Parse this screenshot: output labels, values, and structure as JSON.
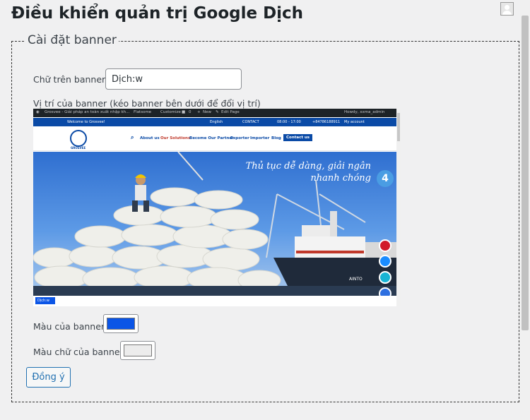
{
  "header": {
    "title": "Điều khiển quản trị Google Dịch"
  },
  "section": {
    "legend": "Cài đặt banner"
  },
  "form": {
    "banner_text_label": "Chữ trên banner:",
    "banner_text_value": "Dịch:w",
    "position_label": "Vị trí của banner (kéo banner bên dưới để đổi vị trí)",
    "banner_color_label": "Màu của banner:",
    "banner_text_color_label": "Màu chữ của banner:",
    "submit_label": "Đồng ý"
  },
  "colors": {
    "banner": "#0b55e6",
    "banner_text": "#ececec"
  },
  "preview": {
    "admin_bar": {
      "site": "Grosvee - Giải pháp an toàn xuất nhập kh...",
      "flatsome": "Flatsome",
      "customize": "Customize",
      "comments": "0",
      "new": "New",
      "edit": "Edit Page",
      "howdy": "Howdy, xxma_admin"
    },
    "top_bar": {
      "welcome": "Welcome to Grosvee!",
      "language": "English",
      "contact": "CONTACT",
      "hours": "08:00 - 17:00",
      "phone": "+84786188911",
      "account": "My account"
    },
    "nav": [
      "About us",
      "Our Solutions",
      "Become Our Partner",
      "Exporter",
      "Importer",
      "Blog"
    ],
    "nav_cta": "Contact us",
    "logo_text": "GROSVEE",
    "hero_line1": "Thủ tục dễ dàng, giải ngân",
    "hero_line2": "nhanh chóng",
    "badge_number": "4",
    "mini_banner": "Dịch:w"
  }
}
